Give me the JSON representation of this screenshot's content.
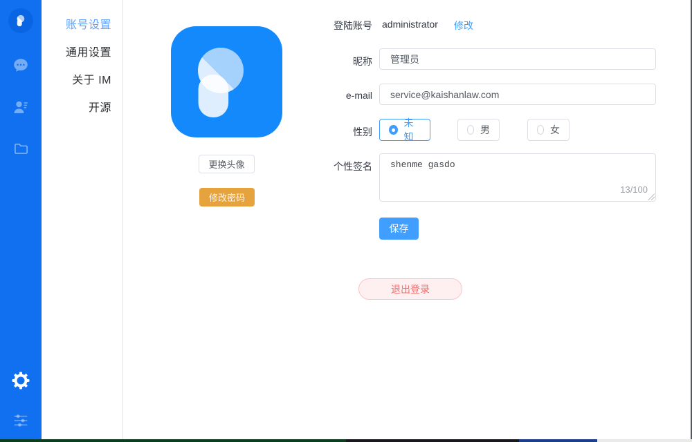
{
  "menu": {
    "items": [
      {
        "label": "账号设置",
        "active": true
      },
      {
        "label": "通用设置",
        "active": false
      },
      {
        "label": "关于 IM",
        "active": false
      },
      {
        "label": "开源",
        "active": false
      }
    ]
  },
  "rail": {
    "icons": [
      "app-logo-avatar",
      "chat-icon",
      "contacts-icon",
      "folder-icon",
      "settings-gear-icon",
      "preferences-sliders-icon"
    ]
  },
  "account": {
    "login_label": "登陆账号",
    "login_value": "administrator",
    "modify_link": "修改",
    "nickname_label": "昵称",
    "nickname_value": "管理员",
    "email_label": "e-mail",
    "email_value": "service@kaishanlaw.com",
    "gender_label": "性别",
    "gender_options": [
      {
        "label": "未知",
        "selected": true
      },
      {
        "label": "男",
        "selected": false
      },
      {
        "label": "女",
        "selected": false
      }
    ],
    "signature_label": "个性签名",
    "signature_value": "shenme gasdo",
    "signature_counter": "13/100",
    "save_label": "保存",
    "change_avatar_label": "更换头像",
    "change_password_label": "修改密码",
    "logout_label": "退出登录"
  },
  "colors": {
    "rail_blue": "#1170f0",
    "app_icon_blue": "#1389fb",
    "avatar_circle_blue": "#0a65e2",
    "accent_blue": "#409eff",
    "active_menu_blue": "#61a0f6",
    "warning_orange": "#e6a23c",
    "logout_bg": "#fef0f0",
    "logout_border": "#fbc4c4",
    "logout_text": "#f56c6c",
    "input_border": "#dcdfe6"
  }
}
